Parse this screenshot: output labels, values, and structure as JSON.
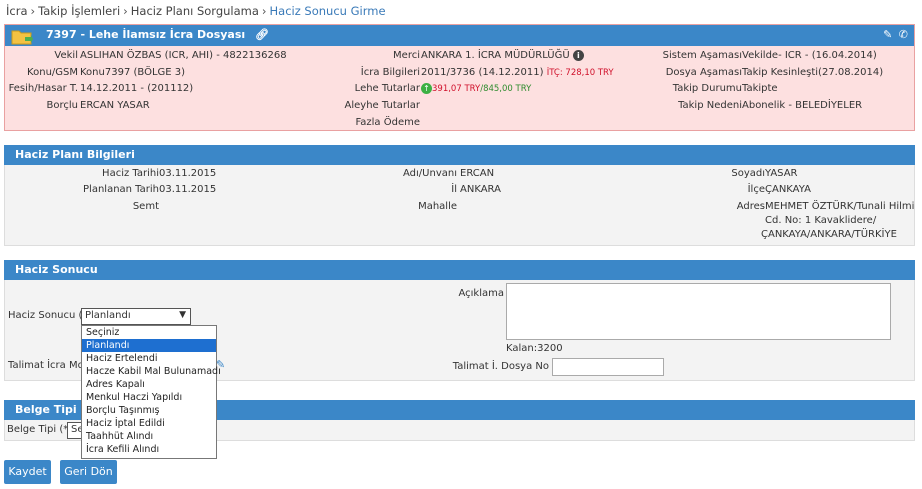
{
  "breadcrumb": [
    "İcra",
    "Takip İşlemleri",
    "Haciz Planı Sorgulama",
    "Haciz Sonucu Girme"
  ],
  "case": {
    "title": "7397 - Lehe İlamsız İcra Dosyası",
    "vekil_label": "Vekil",
    "vekil_value": "ASLIHAN ÖZBAS (ICR, AHI) - 4822136268",
    "konu_label": "Konu/GSM",
    "konu_value": "Konu7397 (BÖLGE 3)",
    "fesih_label": "Fesih/Hasar T.",
    "fesih_value": "14.12.2011 - (201112)",
    "borclu_label": "Borçlu",
    "borclu_value": "ERCAN YASAR",
    "merci_label": "Merci",
    "merci_value": "ANKARA 1. İCRA MÜDÜRLÜĞÜ",
    "icra_label": "İcra Bilgileri",
    "icra_value": "2011/3736 (14.12.2011)",
    "itc_value": "İTÇ: 728,10 TRY",
    "lehe_label": "Lehe Tutarlar",
    "lehe_value1": "391,07 TRY",
    "lehe_value2": "/845,00 TRY",
    "aleyhe_label": "Aleyhe Tutarlar",
    "fazla_label": "Fazla Ödeme",
    "sistem_label": "Sistem Aşaması",
    "sistem_value": "Vekilde- ICR - (16.04.2014)",
    "dosya_label": "Dosya Aşaması",
    "dosya_value": "Takip Kesinleşti(27.08.2014)",
    "durum_label": "Takip Durumu",
    "durum_value": "Takipte",
    "neden_label": "Takip Nedeni",
    "neden_value": "Abonelik - BELEDİYELER"
  },
  "plan": {
    "title": "Haciz Planı Bilgileri",
    "haciz_tarihi_label": "Haciz Tarihi",
    "haciz_tarihi_value": "03.11.2015",
    "planlanan_label": "Planlanan Tarih",
    "planlanan_value": "03.11.2015",
    "semt_label": "Semt",
    "adi_label": "Adı/Unvanı",
    "adi_value": "ERCAN",
    "il_label": "İl",
    "il_value": "ANKARA",
    "mahalle_label": "Mahalle",
    "soyadi_label": "Soyadı",
    "soyadi_value": "YASAR",
    "ilce_label": "İlçe",
    "ilce_value": "ÇANKAYA",
    "adres_label": "Adres",
    "adres_line1": "MEHMET ÖZTÜRK/Tunali Hilmi",
    "adres_line2": "Cd. No: 1 Kavaklidere/",
    "adres_line3": "ÇANKAYA/ANKARA/TÜRKİYE"
  },
  "sonuc": {
    "title": "Haciz Sonucu",
    "haciz_sonucu_label": "Haciz Sonucu (*)",
    "selected": "Planlandı",
    "options": [
      "Seçiniz",
      "Planlandı",
      "Haciz Ertelendi",
      "Hacze Kabil Mal Bulunamadı",
      "Adres Kapalı",
      "Menkul Haczi Yapıldı",
      "Borçlu Taşınmış",
      "Haciz İptal Edildi",
      "Taahhüt Alındı",
      "İcra Kefili Alındı"
    ],
    "aciklama_label": "Açıklama",
    "kalan_label": "Kalan:3200",
    "talimat_md_label": "Talimat İcra Md.",
    "talimat_dosya_label": "Talimat İ. Dosya No"
  },
  "belge": {
    "title": "Belge Tipi",
    "label": "Belge Tipi (*)",
    "value_partial": "Se"
  },
  "buttons": {
    "save": "Kaydet",
    "back": "Geri Dön"
  },
  "colors": {
    "header_blue": "#3b87c8",
    "case_bg": "#fde0e0",
    "select_blue": "#1e6fd0"
  }
}
